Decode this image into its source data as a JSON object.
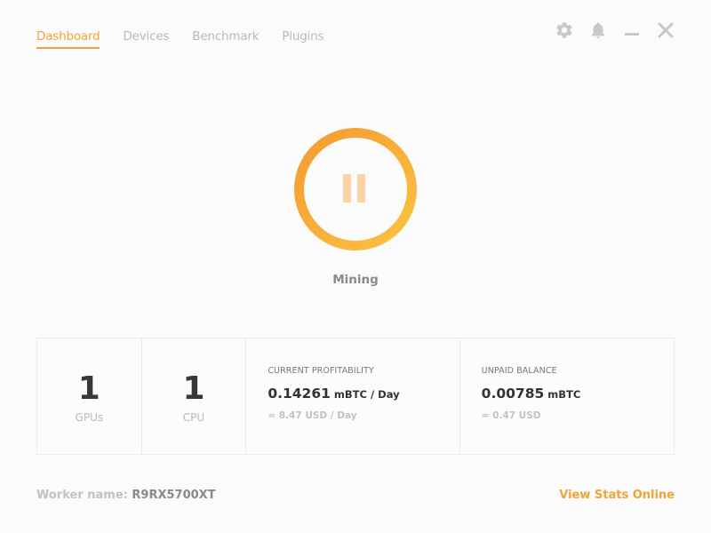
{
  "tabs": [
    {
      "label": "Dashboard",
      "active": true
    },
    {
      "label": "Devices",
      "active": false
    },
    {
      "label": "Benchmark",
      "active": false
    },
    {
      "label": "Plugins",
      "active": false
    }
  ],
  "window_controls": {
    "settings_icon": "gear-icon",
    "notifications_icon": "bell-icon",
    "minimize_icon": "minimize-icon",
    "close_icon": "close-icon"
  },
  "mining": {
    "status_label": "Mining",
    "button_icon": "pause-icon"
  },
  "stats": {
    "gpus": {
      "value": "1",
      "label": "GPUs"
    },
    "cpu": {
      "value": "1",
      "label": "CPU"
    },
    "profitability": {
      "heading": "CURRENT PROFITABILITY",
      "value": "0.14261",
      "unit": "mBTC / Day",
      "fiat": "≈ 8.47 USD / Day"
    },
    "balance": {
      "heading": "UNPAID BALANCE",
      "value": "0.00785",
      "unit": "mBTC",
      "fiat": "≈ 0.47 USD"
    }
  },
  "footer": {
    "worker_label": "Worker name:",
    "worker_value": "R9RX5700XT",
    "stats_link": "View Stats Online"
  },
  "colors": {
    "accent": "#f5a234",
    "ring_start": "#f59a32",
    "ring_end": "#fbc340",
    "pause_fill": "#fcd3a6",
    "icon_gray": "#c8c8c8"
  }
}
